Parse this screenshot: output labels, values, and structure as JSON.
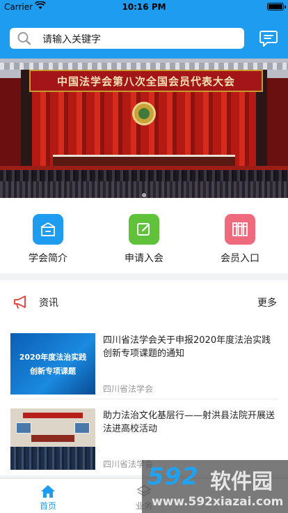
{
  "status_bar": {
    "carrier": "Carrier",
    "time": "10:16 PM"
  },
  "search": {
    "placeholder": "请输入关键字"
  },
  "banner": {
    "headline": "中国法学会第八次全国会员代表大会"
  },
  "quick_actions": [
    {
      "label": "学会简介",
      "icon": "building-icon",
      "color": "#1e9cf0"
    },
    {
      "label": "申请入会",
      "icon": "edit-icon",
      "color": "#5fc23a"
    },
    {
      "label": "会员入口",
      "icon": "books-icon",
      "color": "#f06a7e"
    }
  ],
  "news": {
    "title": "资讯",
    "more": "更多",
    "items": [
      {
        "title": "四川省法学会关于申报2020年度法治实践创新专项课题的通知",
        "source": "四川省法学会",
        "thumb_line1": "2020年度法治实践",
        "thumb_line2": "创新专项课题"
      },
      {
        "title": "助力法治文化基层行——射洪县法院开展送法进高校活动",
        "source": "四川省法学会"
      }
    ]
  },
  "tabbar": [
    {
      "label": "首页",
      "active": true
    },
    {
      "label": "业务",
      "active": false
    }
  ],
  "watermark": {
    "brand": "592",
    "brand_cn": "软件园",
    "url": "www.592xiazai.com"
  },
  "colors": {
    "primary": "#1e9cf0",
    "green": "#5fc23a",
    "pink": "#f06a7e"
  }
}
